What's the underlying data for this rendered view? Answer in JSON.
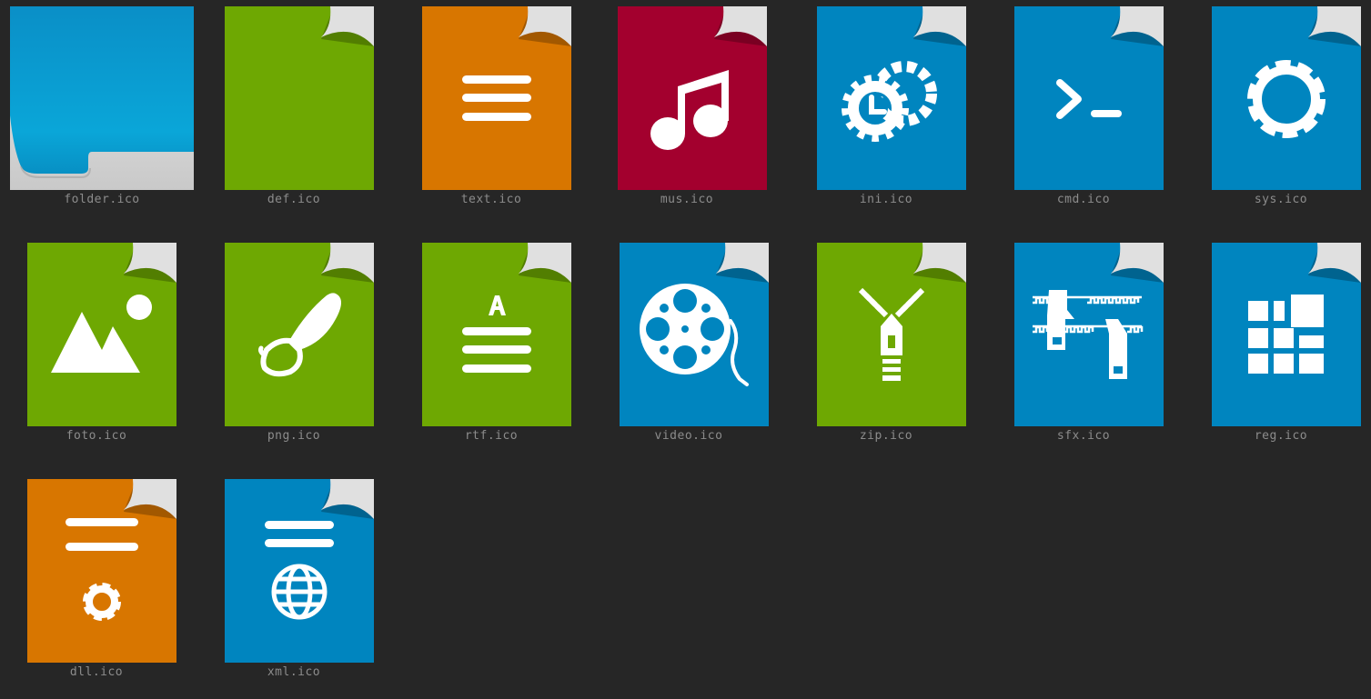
{
  "colors": {
    "background": "#262626",
    "blue": "#0085BF",
    "green": "#6EA802",
    "orange": "#D87600",
    "red": "#A3002E",
    "folder_blue": "#0A93CB",
    "label": "#8C8C8C"
  },
  "icons": [
    {
      "name": "folder.ico",
      "color": "#0A93CB",
      "glyph": "folder-icon"
    },
    {
      "name": "def.ico",
      "color": "#6EA802",
      "glyph": "blank-icon"
    },
    {
      "name": "text.ico",
      "color": "#D87600",
      "glyph": "lines-icon"
    },
    {
      "name": "mus.ico",
      "color": "#A3002E",
      "glyph": "music-note-icon"
    },
    {
      "name": "ini.ico",
      "color": "#0085BF",
      "glyph": "gear-clock-icon"
    },
    {
      "name": "cmd.ico",
      "color": "#0085BF",
      "glyph": "terminal-prompt-icon"
    },
    {
      "name": "sys.ico",
      "color": "#0085BF",
      "glyph": "gear-icon"
    },
    {
      "name": "foto.ico",
      "color": "#6EA802",
      "glyph": "mountain-sun-icon"
    },
    {
      "name": "png.ico",
      "color": "#6EA802",
      "glyph": "paint-brush-icon"
    },
    {
      "name": "rtf.ico",
      "color": "#6EA802",
      "glyph": "letter-a-lines-icon"
    },
    {
      "name": "video.ico",
      "color": "#0085BF",
      "glyph": "film-reel-icon"
    },
    {
      "name": "zip.ico",
      "color": "#6EA802",
      "glyph": "zipper-icon"
    },
    {
      "name": "sfx.ico",
      "color": "#0085BF",
      "glyph": "zipper-open-icon"
    },
    {
      "name": "reg.ico",
      "color": "#0085BF",
      "glyph": "registry-blocks-icon"
    },
    {
      "name": "dll.ico",
      "color": "#D87600",
      "glyph": "document-gear-icon"
    },
    {
      "name": "xml.ico",
      "color": "#0085BF",
      "glyph": "document-globe-icon"
    }
  ]
}
